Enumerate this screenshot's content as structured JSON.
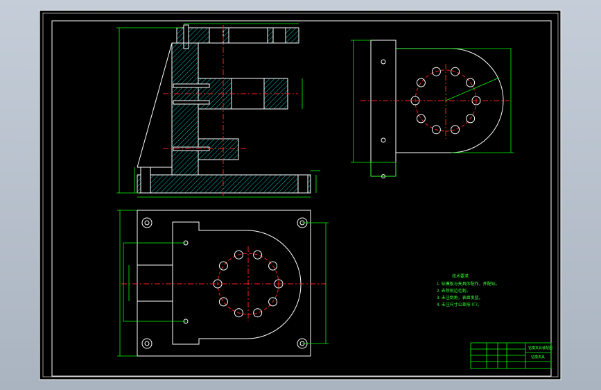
{
  "drawing": {
    "notes_title": "技术要求",
    "notes": [
      "1. 钻模板与夹具体配作，并配钻。",
      "2. 去除锐边毛刺。",
      "3. 未注倒角，表面发蓝。",
      "4. 未注尺寸公差按 IT7。"
    ],
    "title_block": {
      "drawing_name": "钻模夹具装配图",
      "drawing_code": "钻模夹具"
    }
  },
  "colors": {
    "background": "#000000",
    "outline": "#ffffff",
    "dimension": "#00ff00",
    "hatch": "#00c8c8",
    "centerline": "#ff2020",
    "hole_fill": "#ffffff",
    "window_bg": "#b9c3cf"
  }
}
